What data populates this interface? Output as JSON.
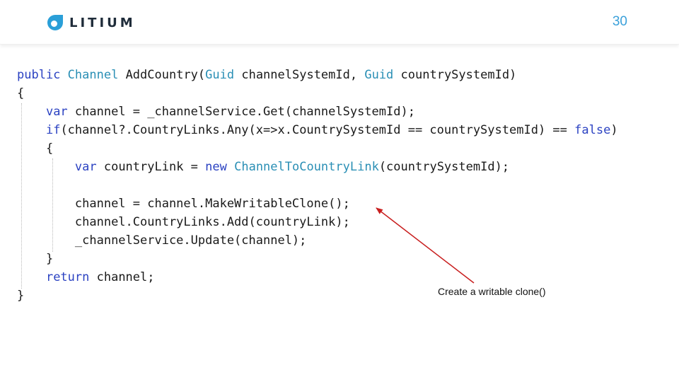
{
  "header": {
    "logo_text": "LITIUM",
    "page_number": "30",
    "colors": {
      "logo_mark": "#2a9fd8",
      "logo_text": "#1f2c3a",
      "page_number": "#3aa0da"
    }
  },
  "code": {
    "colors": {
      "keyword": "#2b42c2",
      "type": "#2a8fb5",
      "text": "#1a1a1a"
    },
    "lines": [
      {
        "indent": "",
        "tokens": [
          {
            "t": "public",
            "c": "kw"
          },
          {
            "t": " "
          },
          {
            "t": "Channel",
            "c": "ty"
          },
          {
            "t": " AddCountry("
          },
          {
            "t": "Guid",
            "c": "ty"
          },
          {
            "t": " channelSystemId, "
          },
          {
            "t": "Guid",
            "c": "ty"
          },
          {
            "t": " countrySystemId)"
          }
        ]
      },
      {
        "indent": "",
        "tokens": [
          {
            "t": "{"
          }
        ]
      },
      {
        "indent": "    ",
        "tokens": [
          {
            "t": "var",
            "c": "kw"
          },
          {
            "t": " channel = _channelService.Get(channelSystemId);"
          }
        ]
      },
      {
        "indent": "    ",
        "tokens": [
          {
            "t": "if",
            "c": "kw"
          },
          {
            "t": "(channel?.CountryLinks.Any(x=>x.CountrySystemId == countrySystemId) == "
          },
          {
            "t": "false",
            "c": "kw"
          },
          {
            "t": ")"
          }
        ]
      },
      {
        "indent": "    ",
        "tokens": [
          {
            "t": "{"
          }
        ]
      },
      {
        "indent": "        ",
        "tokens": [
          {
            "t": "var",
            "c": "kw"
          },
          {
            "t": " countryLink = "
          },
          {
            "t": "new",
            "c": "kw"
          },
          {
            "t": " "
          },
          {
            "t": "ChannelToCountryLink",
            "c": "ty"
          },
          {
            "t": "(countrySystemId);"
          }
        ]
      },
      {
        "indent": "",
        "tokens": []
      },
      {
        "indent": "        ",
        "tokens": [
          {
            "t": "channel = channel.MakeWritableClone();"
          }
        ]
      },
      {
        "indent": "        ",
        "tokens": [
          {
            "t": "channel.CountryLinks.Add(countryLink);"
          }
        ]
      },
      {
        "indent": "        ",
        "tokens": [
          {
            "t": "_channelService.Update(channel);"
          }
        ]
      },
      {
        "indent": "    ",
        "tokens": [
          {
            "t": "}"
          }
        ]
      },
      {
        "indent": "    ",
        "tokens": [
          {
            "t": "return",
            "c": "kw"
          },
          {
            "t": " channel;"
          }
        ]
      },
      {
        "indent": "",
        "tokens": [
          {
            "t": "}"
          }
        ]
      }
    ]
  },
  "annotation": {
    "text": "Create a writable clone()",
    "arrow_color": "#c81e1e"
  }
}
